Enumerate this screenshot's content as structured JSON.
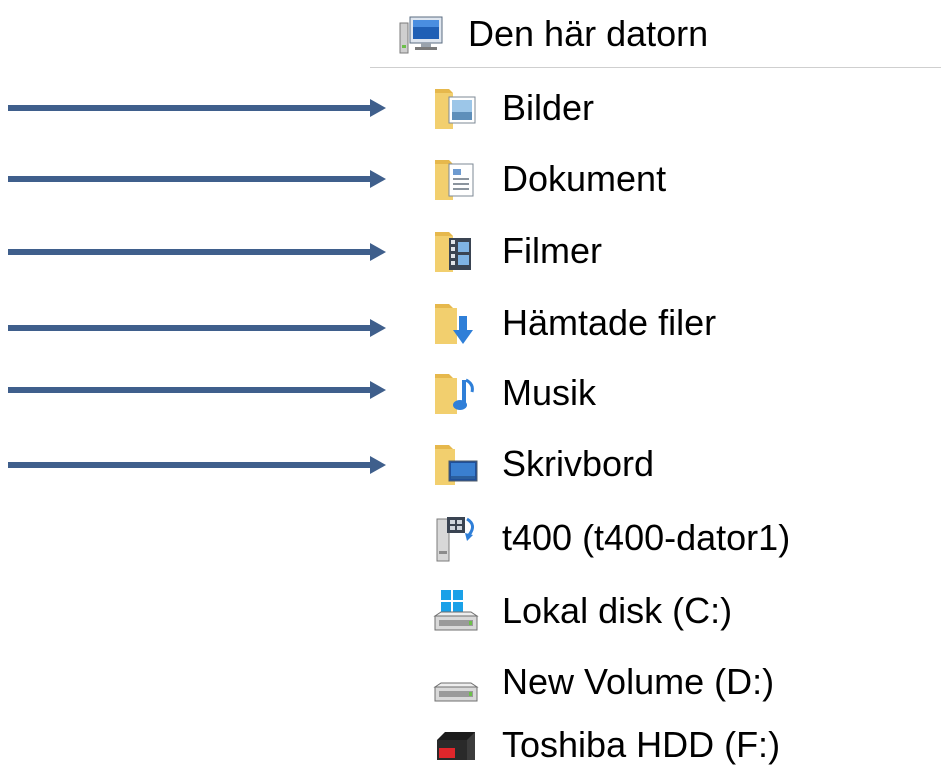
{
  "header": {
    "label": "Den här datorn",
    "icon": "computer-icon"
  },
  "items": [
    {
      "label": "Bilder",
      "icon": "pictures-folder-icon",
      "pointed": true
    },
    {
      "label": "Dokument",
      "icon": "documents-folder-icon",
      "pointed": true
    },
    {
      "label": "Filmer",
      "icon": "videos-folder-icon",
      "pointed": true
    },
    {
      "label": "Hämtade filer",
      "icon": "downloads-folder-icon",
      "pointed": true
    },
    {
      "label": "Musik",
      "icon": "music-folder-icon",
      "pointed": true
    },
    {
      "label": "Skrivbord",
      "icon": "desktop-folder-icon",
      "pointed": true
    },
    {
      "label": "t400 (t400-dator1)",
      "icon": "network-drive-icon",
      "pointed": false
    },
    {
      "label": "Lokal disk (C:)",
      "icon": "windows-drive-icon",
      "pointed": false
    },
    {
      "label": "New Volume (D:)",
      "icon": "hard-drive-icon",
      "pointed": false
    },
    {
      "label": "Toshiba HDD (F:)",
      "icon": "external-drive-icon",
      "pointed": false
    }
  ],
  "colors": {
    "arrow": "#3f5f8c",
    "folder": "#f2cf6e",
    "divider": "#cfcfcf"
  }
}
